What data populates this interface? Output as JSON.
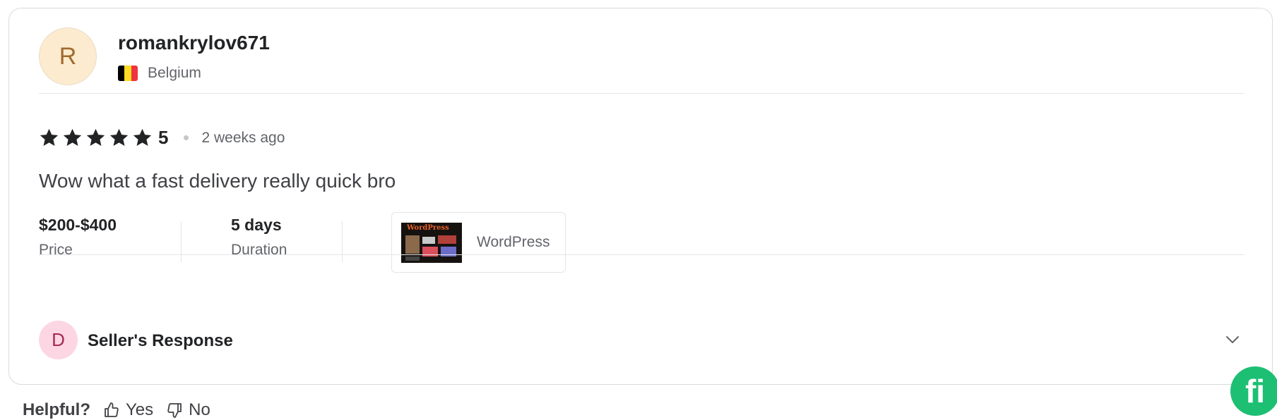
{
  "review": {
    "avatar_initial": "R",
    "username": "romankrylov671",
    "country": "Belgium",
    "flag_colors": [
      "#000000",
      "#fdda24",
      "#ef3340"
    ],
    "rating": "5",
    "stars": 5,
    "time_ago": "2 weeks ago",
    "text": "Wow what a fast delivery really quick bro",
    "price_value": "$200-$400",
    "price_label": "Price",
    "duration_value": "5 days",
    "duration_label": "Duration",
    "gig_name": "WordPress",
    "gig_thumb_title": "WordPress"
  },
  "seller_response": {
    "avatar_initial": "D",
    "label": "Seller's Response"
  },
  "helpful": {
    "question": "Helpful?",
    "yes_label": "Yes",
    "no_label": "No"
  },
  "badge": {
    "label": "fi",
    "color": "#1dbf73"
  }
}
